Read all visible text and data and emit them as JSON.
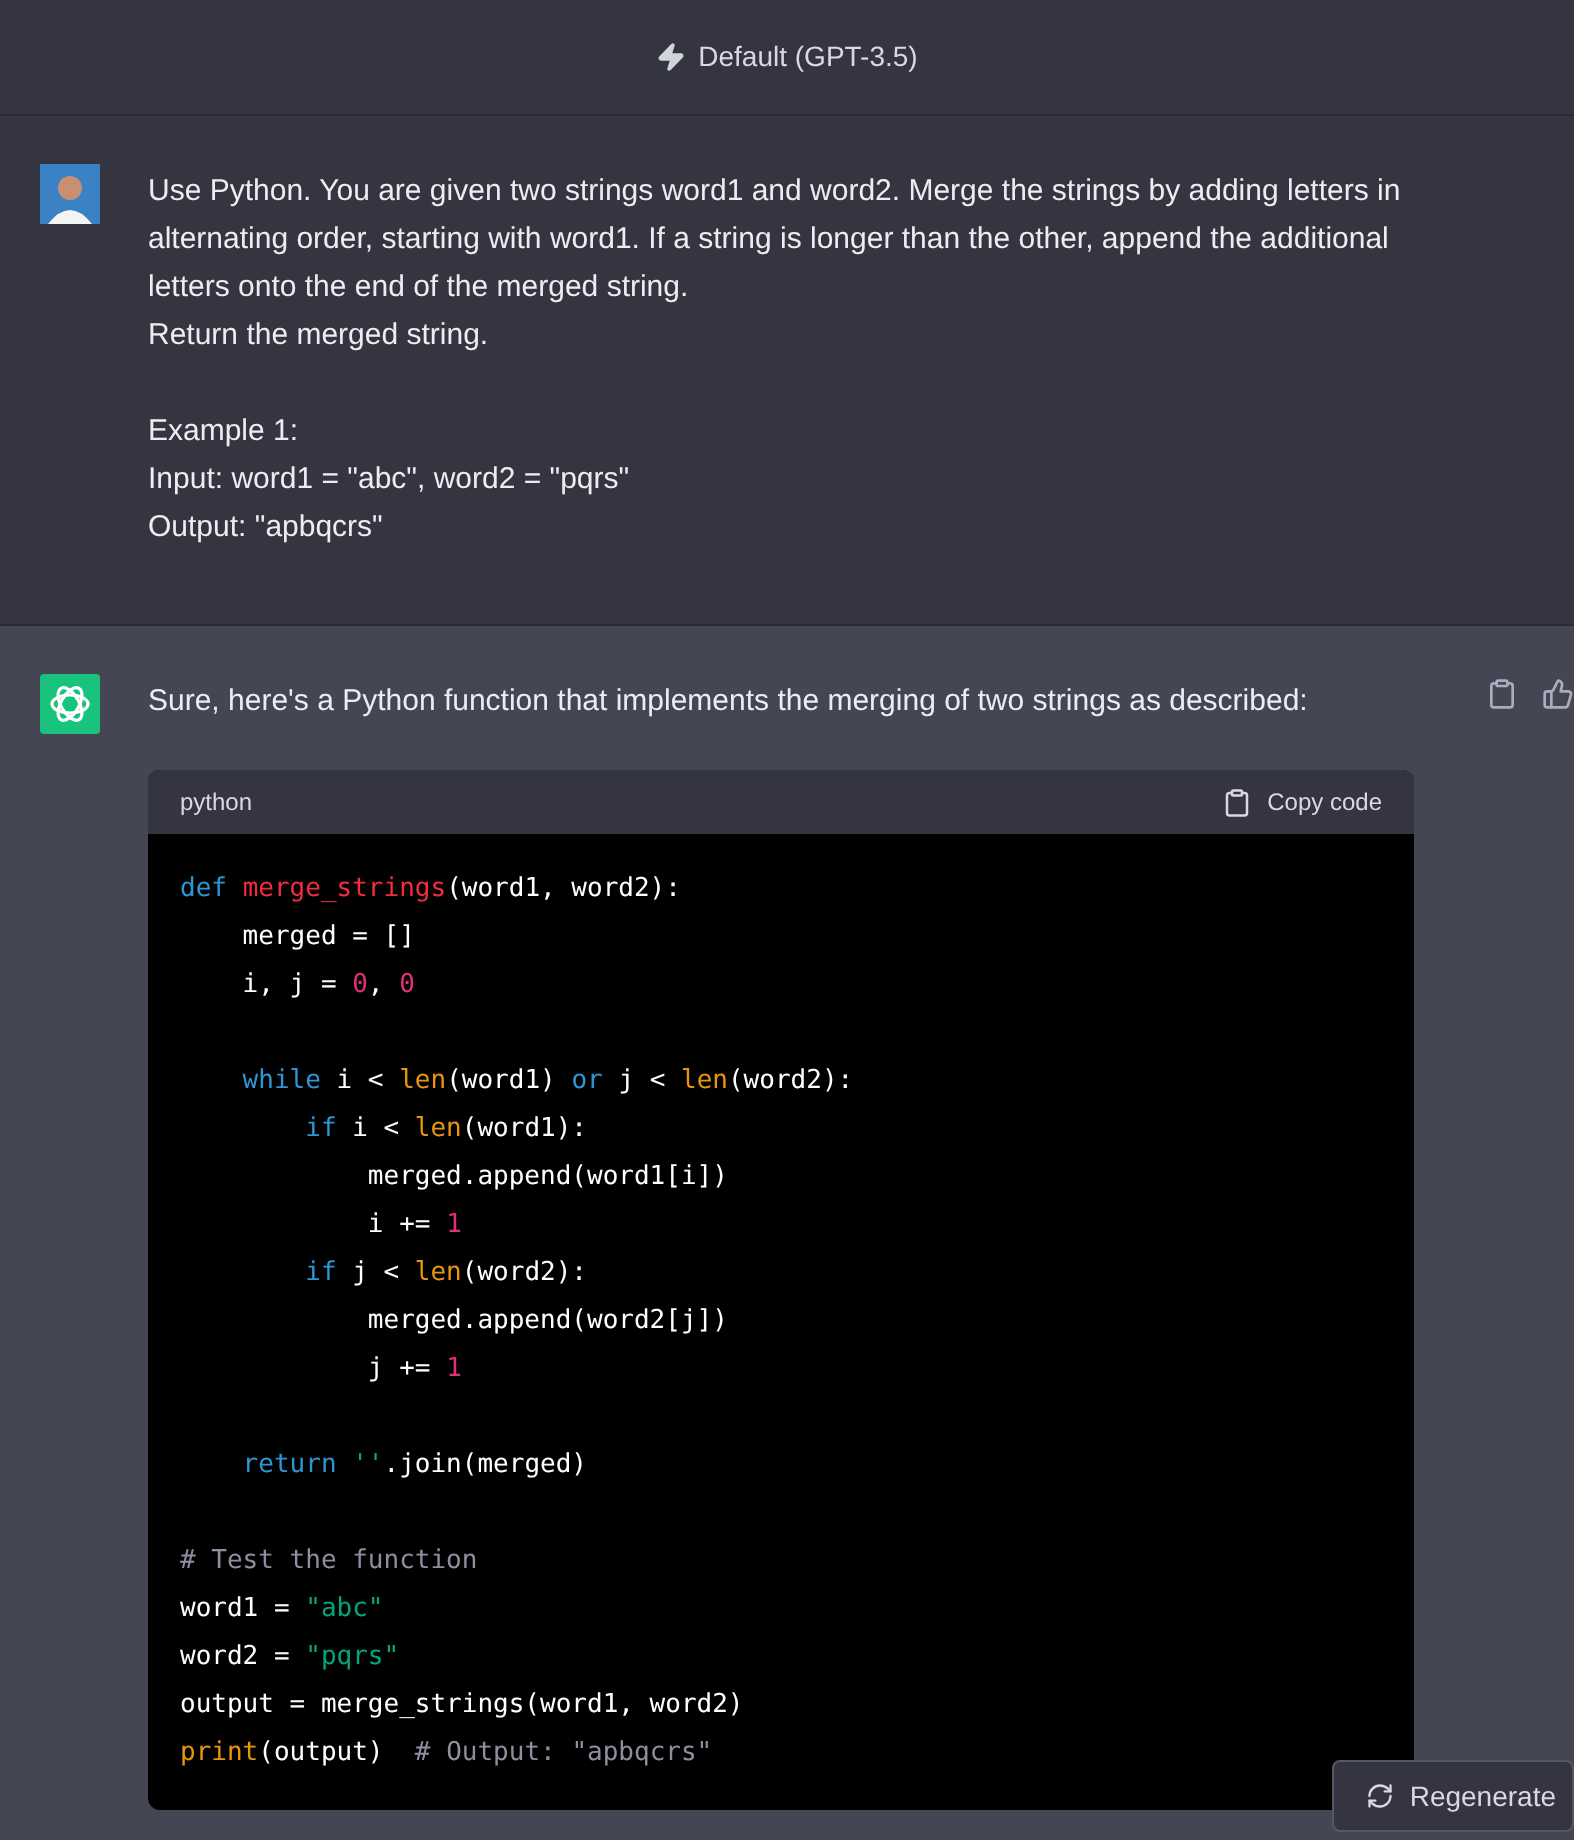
{
  "header": {
    "model": "Default (GPT-3.5)"
  },
  "user_message": {
    "paragraphs": [
      [
        "Use Python. You are given two strings word1 and word2. Merge the strings by adding letters in alternating order, starting with word1. If a string is longer than the other, append the additional letters onto the end of the merged string.",
        "Return the merged string."
      ],
      [
        "Example 1:",
        "Input: word1 = \"abc\", word2 = \"pqrs\"",
        "Output: \"apbqcrs\""
      ]
    ]
  },
  "assistant_message": {
    "text": "Sure, here's a Python function that implements the merging of two strings as described:",
    "code_block": {
      "language": "python",
      "copy_label": "Copy code",
      "lines": [
        {
          "kind": "code",
          "tokens": [
            {
              "kind": "kw",
              "s": "def "
            },
            {
              "kind": "fn",
              "s": "merge_strings"
            },
            {
              "kind": "plain",
              "s": "(word1, word2):"
            }
          ]
        },
        {
          "kind": "code",
          "tokens": [
            {
              "kind": "plain",
              "s": "    merged = []"
            }
          ]
        },
        {
          "kind": "code",
          "tokens": [
            {
              "kind": "plain",
              "s": "    i, j = "
            },
            {
              "kind": "num",
              "s": "0"
            },
            {
              "kind": "plain",
              "s": ", "
            },
            {
              "kind": "num",
              "s": "0"
            }
          ]
        },
        {
          "kind": "blank"
        },
        {
          "kind": "code",
          "tokens": [
            {
              "kind": "kw",
              "s": "    while "
            },
            {
              "kind": "plain",
              "s": "i < "
            },
            {
              "kind": "builtin",
              "s": "len"
            },
            {
              "kind": "plain",
              "s": "(word1) "
            },
            {
              "kind": "kw",
              "s": "or "
            },
            {
              "kind": "plain",
              "s": "j < "
            },
            {
              "kind": "builtin",
              "s": "len"
            },
            {
              "kind": "plain",
              "s": "(word2):"
            }
          ]
        },
        {
          "kind": "code",
          "tokens": [
            {
              "kind": "kw",
              "s": "        if "
            },
            {
              "kind": "plain",
              "s": "i < "
            },
            {
              "kind": "builtin",
              "s": "len"
            },
            {
              "kind": "plain",
              "s": "(word1):"
            }
          ]
        },
        {
          "kind": "code",
          "tokens": [
            {
              "kind": "plain",
              "s": "            merged.append(word1[i])"
            }
          ]
        },
        {
          "kind": "code",
          "tokens": [
            {
              "kind": "plain",
              "s": "            i += "
            },
            {
              "kind": "num",
              "s": "1"
            }
          ]
        },
        {
          "kind": "code",
          "tokens": [
            {
              "kind": "kw",
              "s": "        if "
            },
            {
              "kind": "plain",
              "s": "j < "
            },
            {
              "kind": "builtin",
              "s": "len"
            },
            {
              "kind": "plain",
              "s": "(word2):"
            }
          ]
        },
        {
          "kind": "code",
          "tokens": [
            {
              "kind": "plain",
              "s": "            merged.append(word2[j])"
            }
          ]
        },
        {
          "kind": "code",
          "tokens": [
            {
              "kind": "plain",
              "s": "            j += "
            },
            {
              "kind": "num",
              "s": "1"
            }
          ]
        },
        {
          "kind": "blank"
        },
        {
          "kind": "code",
          "tokens": [
            {
              "kind": "kw",
              "s": "    return "
            },
            {
              "kind": "str",
              "s": "''"
            },
            {
              "kind": "plain",
              "s": ".join(merged)"
            }
          ]
        },
        {
          "kind": "blank"
        },
        {
          "kind": "code",
          "tokens": [
            {
              "kind": "comment",
              "s": "# Test the function"
            }
          ]
        },
        {
          "kind": "code",
          "tokens": [
            {
              "kind": "plain",
              "s": "word1 = "
            },
            {
              "kind": "str",
              "s": "\"abc\""
            }
          ]
        },
        {
          "kind": "code",
          "tokens": [
            {
              "kind": "plain",
              "s": "word2 = "
            },
            {
              "kind": "str",
              "s": "\"pqrs\""
            }
          ]
        },
        {
          "kind": "code",
          "tokens": [
            {
              "kind": "plain",
              "s": "output = merge_strings(word1, word2)"
            }
          ]
        },
        {
          "kind": "code",
          "tokens": [
            {
              "kind": "builtin",
              "s": "print"
            },
            {
              "kind": "plain",
              "s": "(output)  "
            },
            {
              "kind": "comment",
              "s": "# Output: \"apbqcrs\""
            }
          ]
        }
      ]
    }
  },
  "regenerate_button": {
    "label": "Regenerate"
  }
}
